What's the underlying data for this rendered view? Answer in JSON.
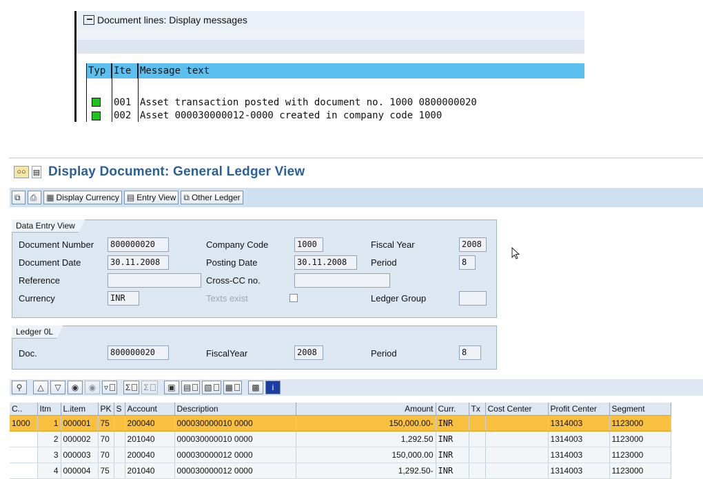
{
  "messages": {
    "title": "Document lines: Display messages",
    "headers": {
      "type": "Typ",
      "item": "Ite",
      "text": "Message text"
    },
    "rows": [
      {
        "item": "001",
        "text": "Asset transaction posted with document no. 1000 0800000020"
      },
      {
        "item": "002",
        "text": "Asset 000030000012-0000 created in company code 1000"
      }
    ]
  },
  "window": {
    "title": "Display Document: General Ledger View",
    "buttons": {
      "display_currency": "Display Currency",
      "entry_view": "Entry View",
      "other_ledger": "Other Ledger"
    }
  },
  "data_entry": {
    "legend": "Data Entry View",
    "document_number_label": "Document Number",
    "document_number": "800000020",
    "company_code_label": "Company Code",
    "company_code": "1000",
    "fiscal_year_label": "Fiscal Year",
    "fiscal_year": "2008",
    "document_date_label": "Document Date",
    "document_date": "30.11.2008",
    "posting_date_label": "Posting Date",
    "posting_date": "30.11.2008",
    "period_label": "Period",
    "period": "8",
    "reference_label": "Reference",
    "reference": "",
    "cross_cc_label": "Cross-CC no.",
    "cross_cc": "",
    "currency_label": "Currency",
    "currency": "INR",
    "texts_exist_label": "Texts exist",
    "ledger_group_label": "Ledger Group",
    "ledger_group": ""
  },
  "ledger": {
    "legend": "Ledger 0L",
    "doc_label": "Doc.",
    "doc": "800000020",
    "fiscal_year_label": "FiscalYear",
    "fiscal_year": "2008",
    "period_label": "Period",
    "period": "8"
  },
  "table": {
    "headers": {
      "c": "C..",
      "itm": "Itm",
      "litem": "L.item",
      "pk": "PK",
      "s": "S",
      "account": "Account",
      "description": "Description",
      "amount": "Amount",
      "curr": "Curr.",
      "tx": "Tx",
      "cost_center": "Cost Center",
      "profit_center": "Profit Center",
      "segment": "Segment"
    },
    "rows": [
      {
        "c": "1000",
        "itm": "1",
        "litem": "000001",
        "pk": "75",
        "account": "200040",
        "description": "000030000010 0000",
        "amount": "150,000.00-",
        "curr": "INR",
        "profit_center": "1314003",
        "segment": "1123000"
      },
      {
        "c": "",
        "itm": "2",
        "litem": "000002",
        "pk": "70",
        "account": "201040",
        "description": "000030000010 0000",
        "amount": "1,292.50",
        "curr": "INR",
        "profit_center": "1314003",
        "segment": "1123000"
      },
      {
        "c": "",
        "itm": "3",
        "litem": "000003",
        "pk": "70",
        "account": "200040",
        "description": "000030000012 0000",
        "amount": "150,000.00",
        "curr": "INR",
        "profit_center": "1314003",
        "segment": "1123000"
      },
      {
        "c": "",
        "itm": "4",
        "litem": "000004",
        "pk": "75",
        "account": "201040",
        "description": "000030000012 0000",
        "amount": "1,292.50-",
        "curr": "INR",
        "profit_center": "1314003",
        "segment": "1123000"
      }
    ]
  },
  "colors": {
    "status_ok": "#18c618",
    "header_highlight": "#5bbff0",
    "selected_row": "#f9bf3f",
    "title_blue": "#2a5f9a"
  }
}
